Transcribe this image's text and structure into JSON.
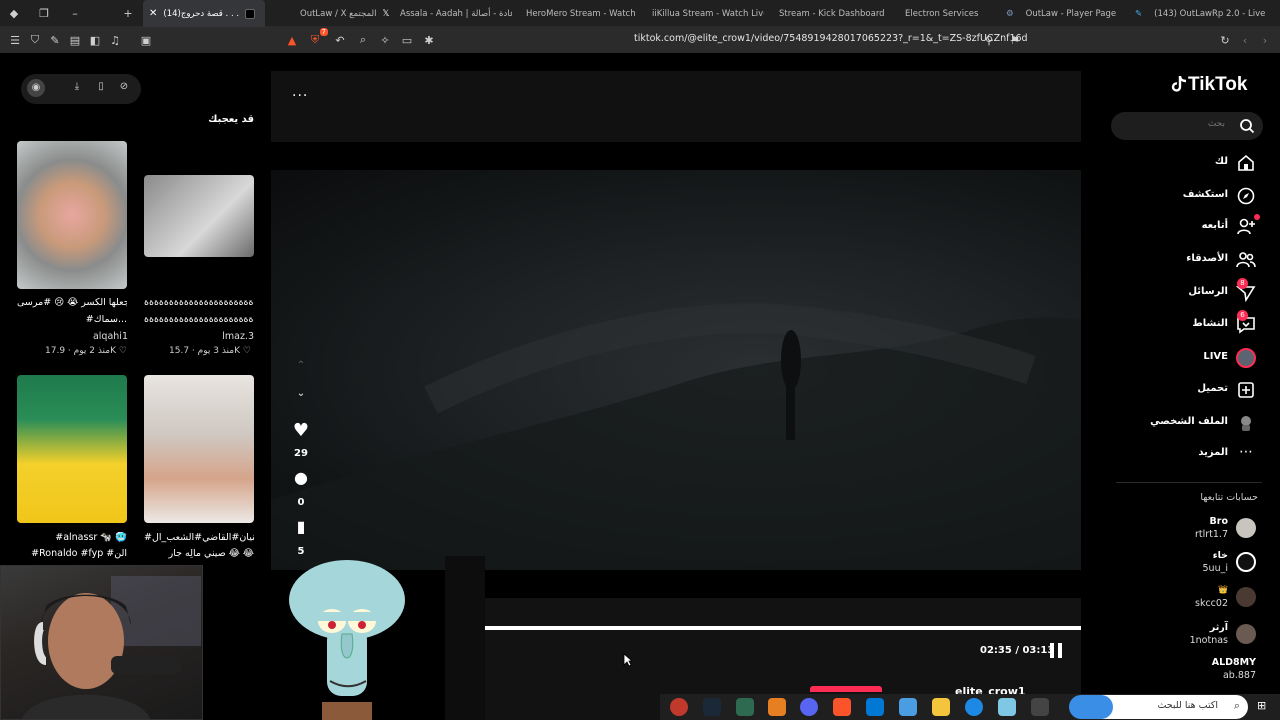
{
  "browser": {
    "tabs": [
      {
        "title": "(14)قصة دحروج . . .",
        "active": true
      },
      {
        "title": "OutLaw / X المجتمع"
      },
      {
        "title": "Assala - Aadah | عادة - أصالة"
      },
      {
        "title": "HeroMero Stream - Watch"
      },
      {
        "title": "iiKillua Stream - Watch Live"
      },
      {
        "title": "Stream - Kick Dashboard"
      },
      {
        "title": "Electron Services"
      },
      {
        "title": "OutLaw - Player Page"
      },
      {
        "title": "(143) OutLawRp 2.0 - Live"
      }
    ],
    "url": "tiktok.com/@elite_crow1/video/7548919428017065223?_r=1&_t=ZS-8zfUCZnf16d",
    "badge_count": "7"
  },
  "tiktok": {
    "logo": "TikTok",
    "search_placeholder": "بحث",
    "nav": [
      {
        "label": "لك",
        "icon": "home-icon"
      },
      {
        "label": "استكشف",
        "icon": "compass-icon"
      },
      {
        "label": "أتابعه",
        "icon": "user-plus-icon"
      },
      {
        "label": "الأصدقاء",
        "icon": "friends-icon"
      },
      {
        "label": "الرسائل",
        "icon": "send-icon",
        "badge": "8"
      },
      {
        "label": "النشاط",
        "icon": "message-icon",
        "badge": "6"
      },
      {
        "label": "LIVE",
        "icon": "live-icon"
      },
      {
        "label": "تحميل",
        "icon": "upload-icon"
      },
      {
        "label": "الملف الشخصي",
        "icon": "profile-icon"
      },
      {
        "label": "المزيد",
        "icon": "more-icon"
      }
    ],
    "following_title": "حسابات تتابعها",
    "following": [
      {
        "name": "Bro",
        "handle": "rtlrt1.7"
      },
      {
        "name": "خاء",
        "handle": "5uu_i"
      },
      {
        "name": "👑",
        "handle": "skcc02"
      },
      {
        "name": "آرثر",
        "handle": "1notnas"
      },
      {
        "name": "ALD8MY",
        "handle": "ab.887"
      }
    ]
  },
  "player": {
    "more": "...",
    "likes": "29",
    "comments": "0",
    "saves": "5",
    "time": "02:35 / 03:13",
    "progress": 0.81,
    "author": "elite_crow1"
  },
  "left_panel": {
    "title": "قد يعجبك",
    "videos": [
      {
        "caption_1": "جعلها الكسر 😭 😢 #مرسى",
        "caption_2": "#سماك...",
        "user": "alqahi1",
        "likes": "17.9K",
        "age": "منذ 2 يوم"
      },
      {
        "caption_1": "ةةةةةةةةةةةةةةةةةةةةةةةة",
        "caption_2": "ةةةةةةةةةةةةةةةةةةةةةةة...",
        "user": "lmaz.3",
        "likes": "15.7K",
        "age": "منذ 3 يوم"
      },
      {
        "caption_1": "#alnassr 🐄 🥶",
        "caption_2": "#Ronaldo #fyp #الن"
      },
      {
        "caption_1": "#ابوسنيان#القاضي#الشعب_ال",
        "caption_2": "صيني مالِه جار 😂 😂"
      }
    ]
  },
  "taskbar": {
    "search_text": "اكتب هنا للبحث"
  }
}
